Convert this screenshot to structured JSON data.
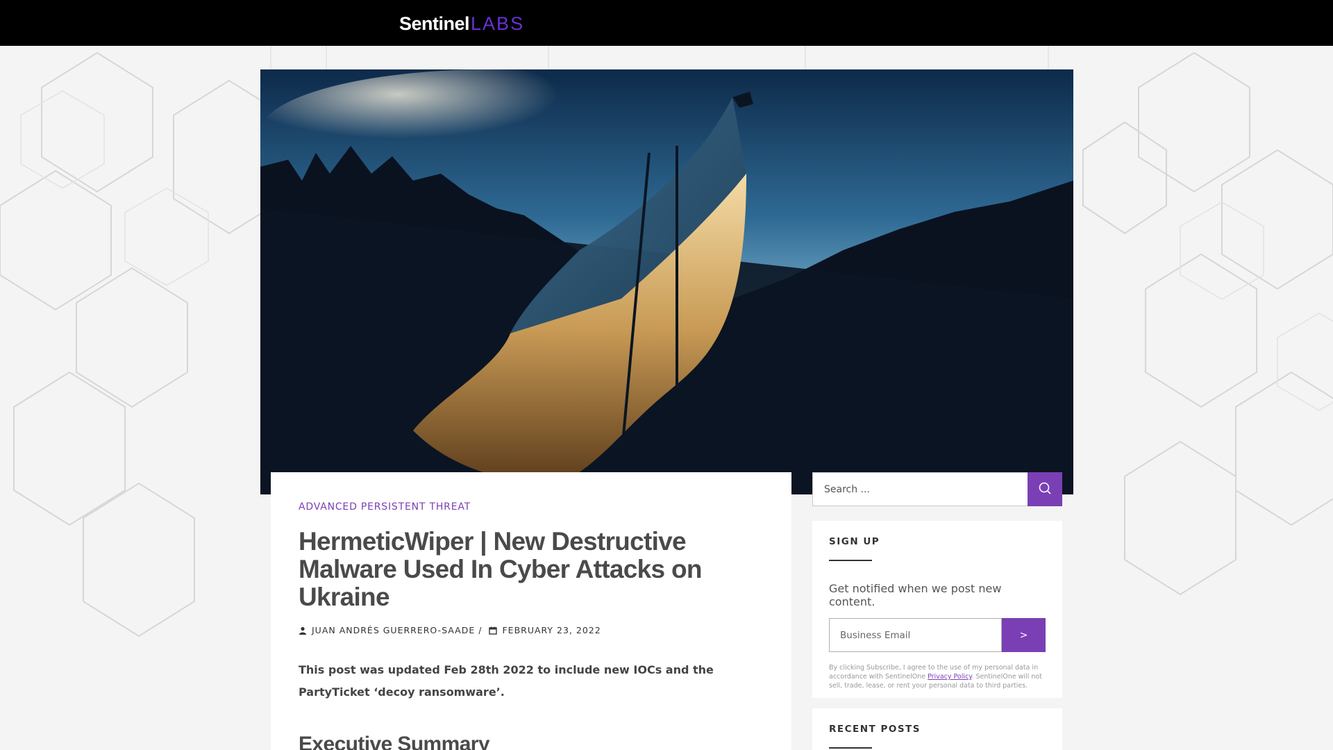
{
  "header": {
    "logo_main": "Sentinel",
    "logo_sub": "LABS"
  },
  "hero": {
    "image": "ukrainian-flag-silhouette-photo"
  },
  "article": {
    "category": "ADVANCED PERSISTENT THREAT",
    "title": "HermeticWiper | New Destructive Malware Used In Cyber Attacks on Ukraine",
    "author": "JUAN ANDRÉS GUERRERO-SAADE",
    "separator": "/",
    "date": "FEBRUARY 23, 2022",
    "intro": "This post was updated Feb 28th 2022 to include new IOCs and the PartyTicket ‘decoy ransomware’.",
    "section_heading": "Executive Summary",
    "author_icon": "user-icon",
    "date_icon": "calendar-icon"
  },
  "sidebar": {
    "search_placeholder": "Search ...",
    "search_icon": "search-icon",
    "signup": {
      "title": "SIGN UP",
      "text": "Get notified when we post new content.",
      "email_placeholder": "Business Email",
      "submit_label": ">",
      "legal_before": "By clicking Subscribe, I agree to the use of my personal data in accordance with SentinelOne ",
      "legal_link": "Privacy Policy",
      "legal_after": ". SentinelOne will not sell, trade, lease, or rent your personal data to third parties."
    },
    "recent_posts_title": "RECENT POSTS"
  },
  "colors": {
    "accent": "#7a3fb5",
    "topbar": "#000000",
    "page_bg": "#f4f4f4"
  }
}
